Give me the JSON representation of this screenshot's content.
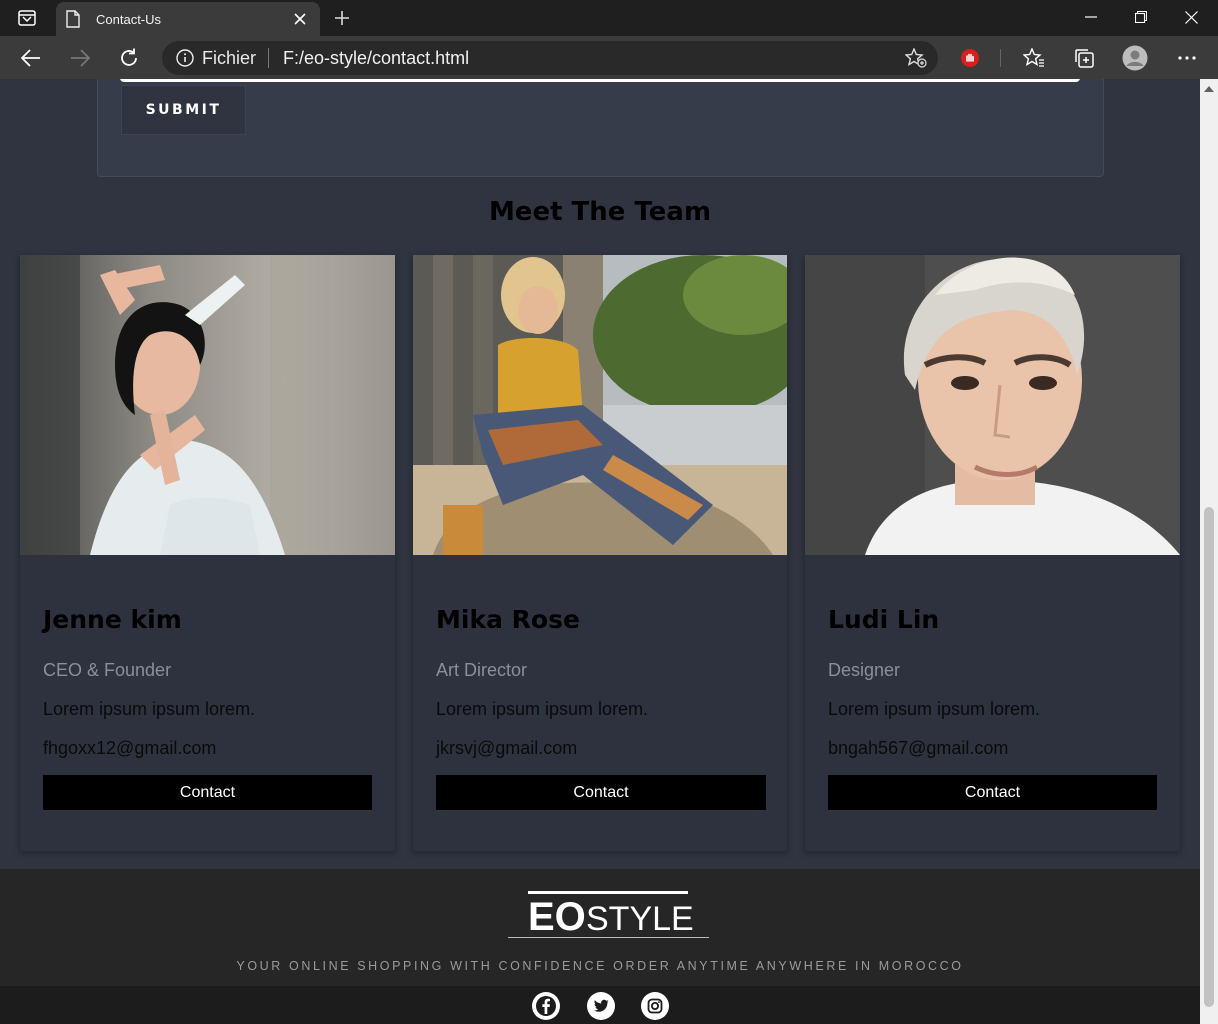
{
  "browser": {
    "tab_title": "Contact-Us",
    "address_scheme": "Fichier",
    "address_url": "F:/eo-style/contact.html"
  },
  "form": {
    "submit_label": "SUBMIT"
  },
  "team": {
    "title": "Meet The Team",
    "members": [
      {
        "name": "Jenne kim",
        "role": "CEO & Founder",
        "description": "Lorem ipsum ipsum lorem.",
        "email": "fhgoxx12@gmail.com",
        "button": "Contact"
      },
      {
        "name": "Mika Rose",
        "role": "Art Director",
        "description": "Lorem ipsum ipsum lorem.",
        "email": "jkrsvj@gmail.com",
        "button": "Contact"
      },
      {
        "name": "Ludi Lin",
        "role": "Designer",
        "description": "Lorem ipsum ipsum lorem.",
        "email": "bngah567@gmail.com",
        "button": "Contact"
      }
    ]
  },
  "footer": {
    "logo_text": "EOSTYLE",
    "tagline": "YOUR ONLINE SHOPPING WITH CONFIDENCE ORDER ANYTIME ANYWHERE IN MOROCCO",
    "social": [
      "facebook-icon",
      "twitter-icon",
      "instagram-icon"
    ]
  },
  "colors": {
    "page_bg": "#2f3440",
    "card_bg": "#2d323e",
    "footer_bg": "#262626",
    "button_bg": "#000000"
  }
}
